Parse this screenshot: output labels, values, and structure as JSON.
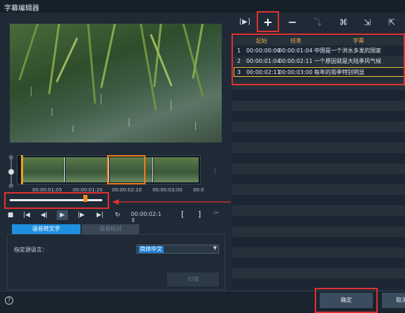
{
  "window": {
    "title": "字幕编辑器"
  },
  "timeline": {
    "timecodes": [
      "00:00:01:05",
      "00:00:01:20",
      "00:00:02:10",
      "00:00:03:00",
      "00:0"
    ],
    "current_time": "00:00:02:1"
  },
  "controls": {
    "timecode_stepper": "⇕",
    "mark_in": "[",
    "mark_out": "]"
  },
  "speech": {
    "tabs": [
      "语音转文字",
      "语音校对"
    ],
    "source_language_label": "指定源语言：",
    "source_language_value": "简体中文",
    "scan_button": "扫描"
  },
  "table": {
    "headers": [
      "起始",
      "结束",
      "字幕"
    ],
    "rows": [
      {
        "index": "1",
        "start": "00:00:00:00",
        "end": "00:00:01:04",
        "text": "中国是一个洪水多发的国家"
      },
      {
        "index": "2",
        "start": "00:00:01:04",
        "end": "00:00:02:11",
        "text": "一个原因就是大陆季风气候"
      },
      {
        "index": "3",
        "start": "00:00:02:11",
        "end": "00:00:03:00",
        "text": "每年的雨季特别明显"
      }
    ]
  },
  "annotations": {
    "n1": "1",
    "n2": "2",
    "n3": "3"
  },
  "footer": {
    "help": "?",
    "ok_label": "确定",
    "cancel_label": "取消"
  },
  "colors": {
    "accent": "#1e90e0",
    "annotation": "#e23030",
    "selection": "#f07d20",
    "header_text": "#e8a54b"
  }
}
